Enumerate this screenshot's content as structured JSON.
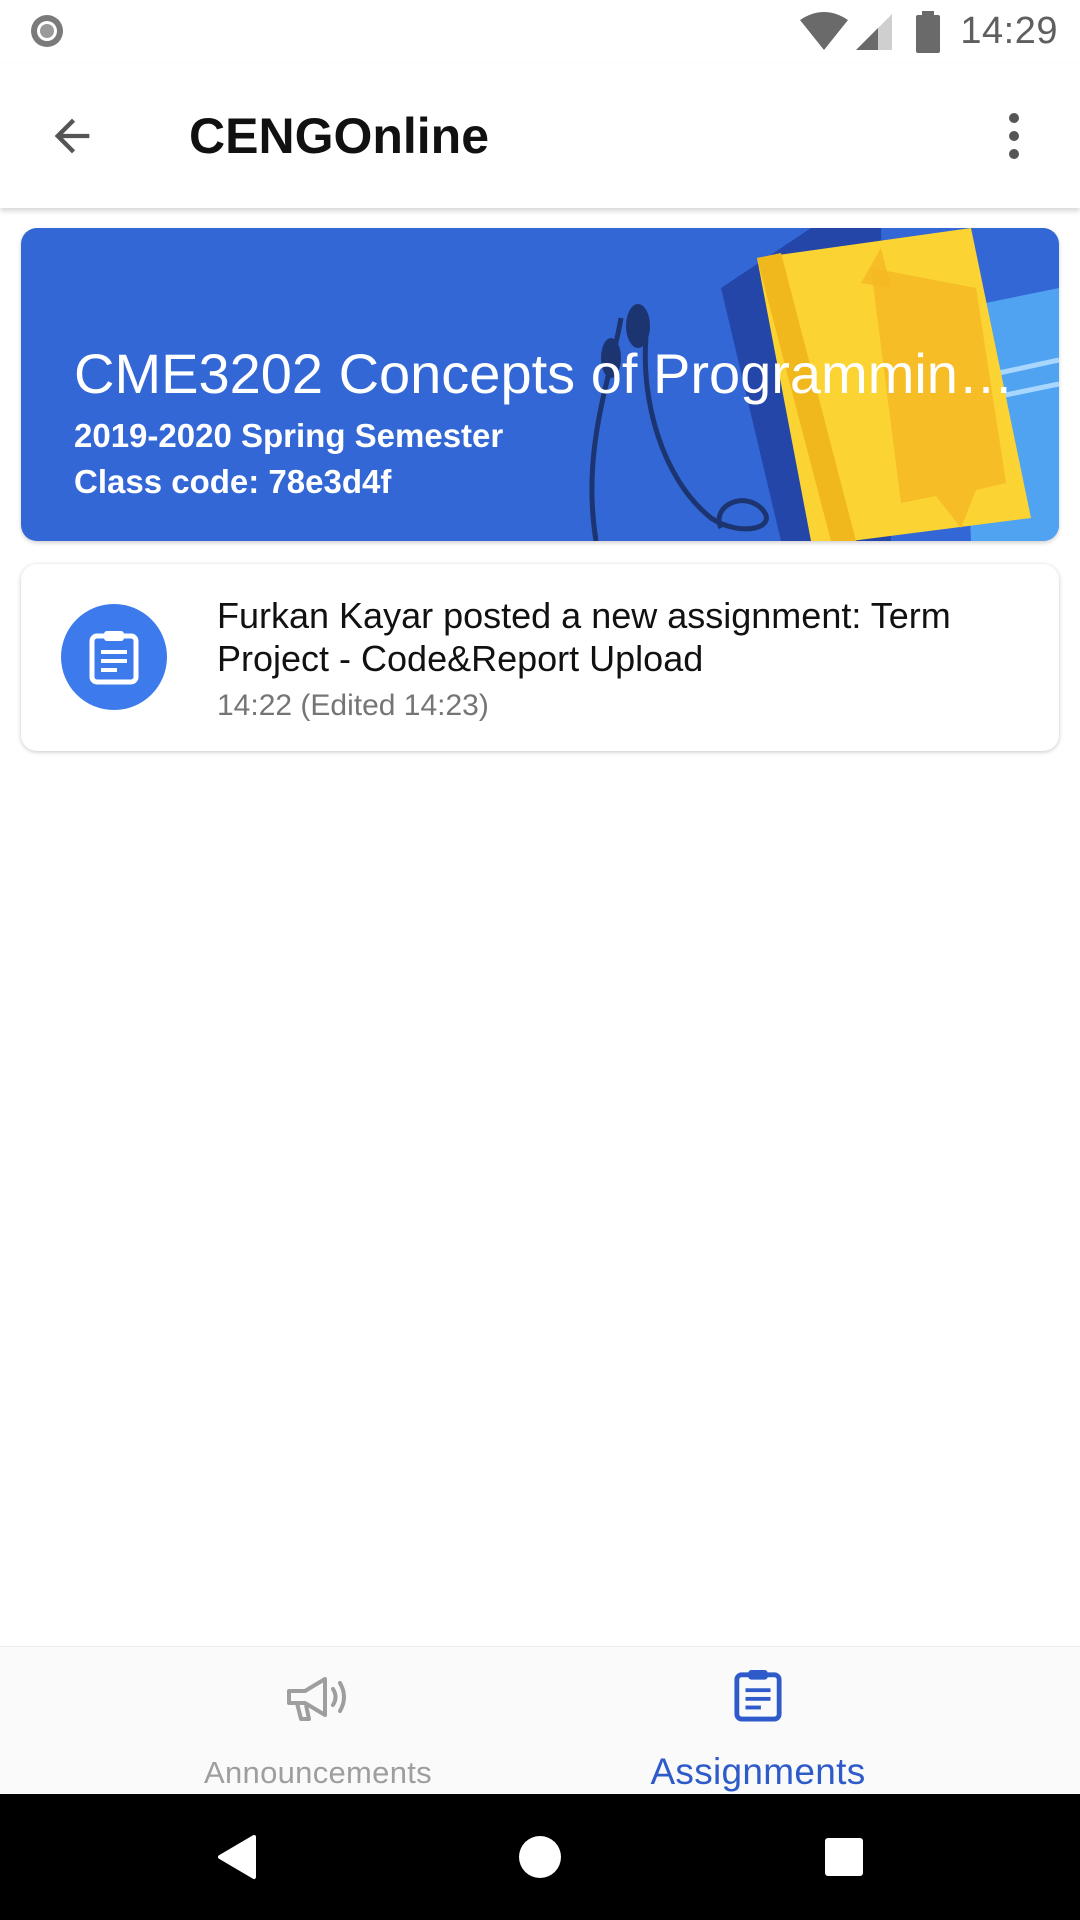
{
  "status_bar": {
    "time": "14:29",
    "icons": [
      "record-icon",
      "wifi-icon",
      "cellular-signal-icon",
      "battery-icon"
    ]
  },
  "app_bar": {
    "title": "CENGOnline",
    "back_icon": "arrow-back-icon",
    "menu_icon": "more-vertical-icon"
  },
  "class_banner": {
    "title": "CME3202 Concepts of Programmin…",
    "semester": "2019-2020 Spring Semester",
    "class_code": "Class code: 78e3d4f",
    "color": "#3367d6"
  },
  "assignments": [
    {
      "icon": "assignment-icon",
      "text": "Furkan Kayar posted a new assignment: Term Project - Code&Report Upload",
      "time": "14:22 (Edited 14:23)"
    }
  ],
  "bottom_nav": {
    "tabs": [
      {
        "label": "Announcements",
        "icon": "megaphone-icon",
        "selected": false
      },
      {
        "label": "Assignments",
        "icon": "assignment-icon",
        "selected": true
      }
    ],
    "active_color": "#2e5bc9",
    "inactive_color": "#9e9e9e"
  },
  "system_nav": {
    "buttons": [
      "back-triangle-icon",
      "home-circle-icon",
      "recents-square-icon"
    ]
  }
}
